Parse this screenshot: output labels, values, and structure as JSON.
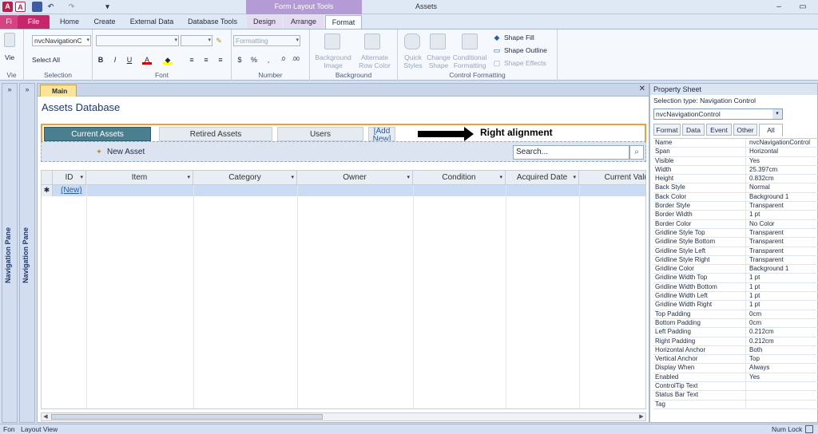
{
  "window": {
    "title": "Assets",
    "context_title": "Form Layout Tools"
  },
  "tabs": {
    "file_stub": "Fi",
    "file": "File",
    "home": "Home",
    "create": "Create",
    "external": "External Data",
    "dbtools": "Database Tools",
    "design": "Design",
    "arrange": "Arrange",
    "format": "Format"
  },
  "ribbon": {
    "view_label": "Vie",
    "object_combo": "nvcNavigationC",
    "select_all": "Select All",
    "selection_group": "Selection",
    "view_group": "Vie",
    "font_group": "Font",
    "number_group": "Number",
    "number_format": "Formatting",
    "background_group": "Background",
    "background_image": "Background\nImage",
    "alt_row_color": "Alternate\nRow Color",
    "cf_group": "Control Formatting",
    "quick_styles": "Quick\nStyles",
    "change_shape": "Change\nShape",
    "conditional_formatting": "Conditional\nFormatting",
    "shape_fill": "Shape Fill",
    "shape_outline": "Shape Outline",
    "shape_effects": "Shape Effects",
    "bold": "B",
    "italic": "I",
    "underline": "U",
    "percent": "%",
    "comma": ","
  },
  "nav_pane": {
    "label": "Navigation Pane"
  },
  "document": {
    "tab": "Main",
    "form_title": "Assets Database",
    "nav_tabs": [
      "Current Assets",
      "Retired Assets",
      "Users",
      "[Add\nNew]"
    ],
    "annotation": "Right alignment",
    "new_asset": "New Asset",
    "search_placeholder": "Search...",
    "grid_columns": [
      "ID",
      "Item",
      "Category",
      "Owner",
      "Condition",
      "Acquired Date",
      "Current Valu"
    ],
    "new_row_marker": "✱",
    "new_row_label": "(New)"
  },
  "property_sheet": {
    "title": "Property Sheet",
    "selection_type": "Selection type:  Navigation Control",
    "combo_value": "nvcNavigationControl",
    "tabs": [
      "Format",
      "Data",
      "Event",
      "Other",
      "All"
    ],
    "active_tab": "All",
    "rows": [
      {
        "k": "Name",
        "v": "nvcNavigationControl"
      },
      {
        "k": "Span",
        "v": "Horizontal"
      },
      {
        "k": "Visible",
        "v": "Yes"
      },
      {
        "k": "Width",
        "v": "25.397cm"
      },
      {
        "k": "Height",
        "v": "0.832cm"
      },
      {
        "k": "Back Style",
        "v": "Normal"
      },
      {
        "k": "Back Color",
        "v": "Background 1"
      },
      {
        "k": "Border Style",
        "v": "Transparent"
      },
      {
        "k": "Border Width",
        "v": "1 pt"
      },
      {
        "k": "Border Color",
        "v": "No Color"
      },
      {
        "k": "Gridline Style Top",
        "v": "Transparent"
      },
      {
        "k": "Gridline Style Bottom",
        "v": "Transparent"
      },
      {
        "k": "Gridline Style Left",
        "v": "Transparent"
      },
      {
        "k": "Gridline Style Right",
        "v": "Transparent"
      },
      {
        "k": "Gridline Color",
        "v": "Background 1"
      },
      {
        "k": "Gridline Width Top",
        "v": "1 pt"
      },
      {
        "k": "Gridline Width Bottom",
        "v": "1 pt"
      },
      {
        "k": "Gridline Width Left",
        "v": "1 pt"
      },
      {
        "k": "Gridline Width Right",
        "v": "1 pt"
      },
      {
        "k": "Top Padding",
        "v": "0cm"
      },
      {
        "k": "Bottom Padding",
        "v": "0cm"
      },
      {
        "k": "Left Padding",
        "v": "0.212cm"
      },
      {
        "k": "Right Padding",
        "v": "0.212cm"
      },
      {
        "k": "Horizontal Anchor",
        "v": "Both"
      },
      {
        "k": "Vertical Anchor",
        "v": "Top"
      },
      {
        "k": "Display When",
        "v": "Always"
      },
      {
        "k": "Enabled",
        "v": "Yes"
      },
      {
        "k": "ControlTip Text",
        "v": ""
      },
      {
        "k": "Status Bar Text",
        "v": ""
      },
      {
        "k": "Tag",
        "v": ""
      }
    ]
  },
  "status": {
    "left_stub": "Fon",
    "mode": "Layout View",
    "num_lock": "Num Lock"
  },
  "colors": {
    "accent_tab": "#4a7f8f",
    "file_tab": "#c8266a",
    "context": "#b59bd6",
    "highlight": "#f0a030"
  }
}
